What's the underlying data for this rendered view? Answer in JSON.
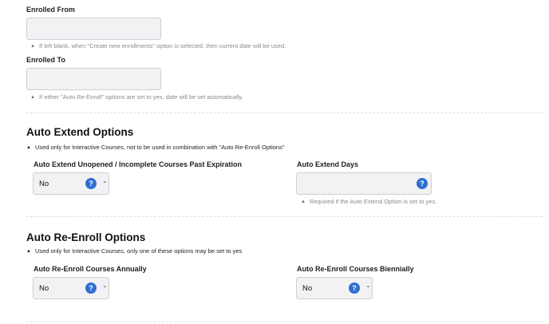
{
  "enrolled_from": {
    "label": "Enrolled From",
    "value": "",
    "hint": "If left blank, when \"Create new enrollments\" option is selected, then current date will be used."
  },
  "enrolled_to": {
    "label": "Enrolled To",
    "value": "",
    "hint": "If either \"Auto Re-Enroll\" options are set to yes, date will be set automatically."
  },
  "auto_extend": {
    "title": "Auto Extend Options",
    "note": "Used only for Interactive Courses, not to be used in combination with \"Auto Re-Enroll Options\"",
    "past_expiration": {
      "label": "Auto Extend Unopened / Incomplete Courses Past Expiration",
      "value": "No"
    },
    "days": {
      "label": "Auto Extend Days",
      "value": "",
      "hint": "Required if the Auto Extend Option is set to yes."
    }
  },
  "auto_reenroll": {
    "title": "Auto Re-Enroll Options",
    "note": "Used only for Interactive Courses, only one of these options may be set to yes",
    "annually": {
      "label": "Auto Re-Enroll Courses Annually",
      "value": "No"
    },
    "biennially": {
      "label": "Auto Re-Enroll Courses Biennially",
      "value": "No"
    }
  },
  "icons": {
    "help": "?",
    "caret_up": "▲",
    "chevron_down": "⌄"
  }
}
